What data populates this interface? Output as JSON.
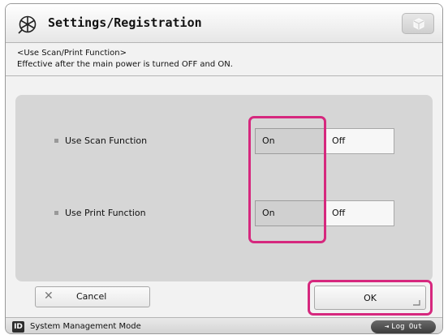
{
  "header": {
    "title": "Settings/Registration",
    "title_icon": "settings-star-icon",
    "right_button_icon": "cube-icon"
  },
  "info": {
    "section": "<Use Scan/Print Function>",
    "note": "Effective after the main power is turned OFF and ON."
  },
  "rows": [
    {
      "label": "Use Scan Function",
      "on": "On",
      "off": "Off",
      "selected": "On"
    },
    {
      "label": "Use Print Function",
      "on": "On",
      "off": "Off",
      "selected": "On"
    }
  ],
  "buttons": {
    "cancel": "Cancel",
    "ok": "OK"
  },
  "status": {
    "mode_badge": "ID",
    "mode": "System Management Mode",
    "logout": "Log Out"
  },
  "colors": {
    "highlight": "#d6287e",
    "panel": "#d6d6d6",
    "selected_button": "#d0d0d0"
  }
}
